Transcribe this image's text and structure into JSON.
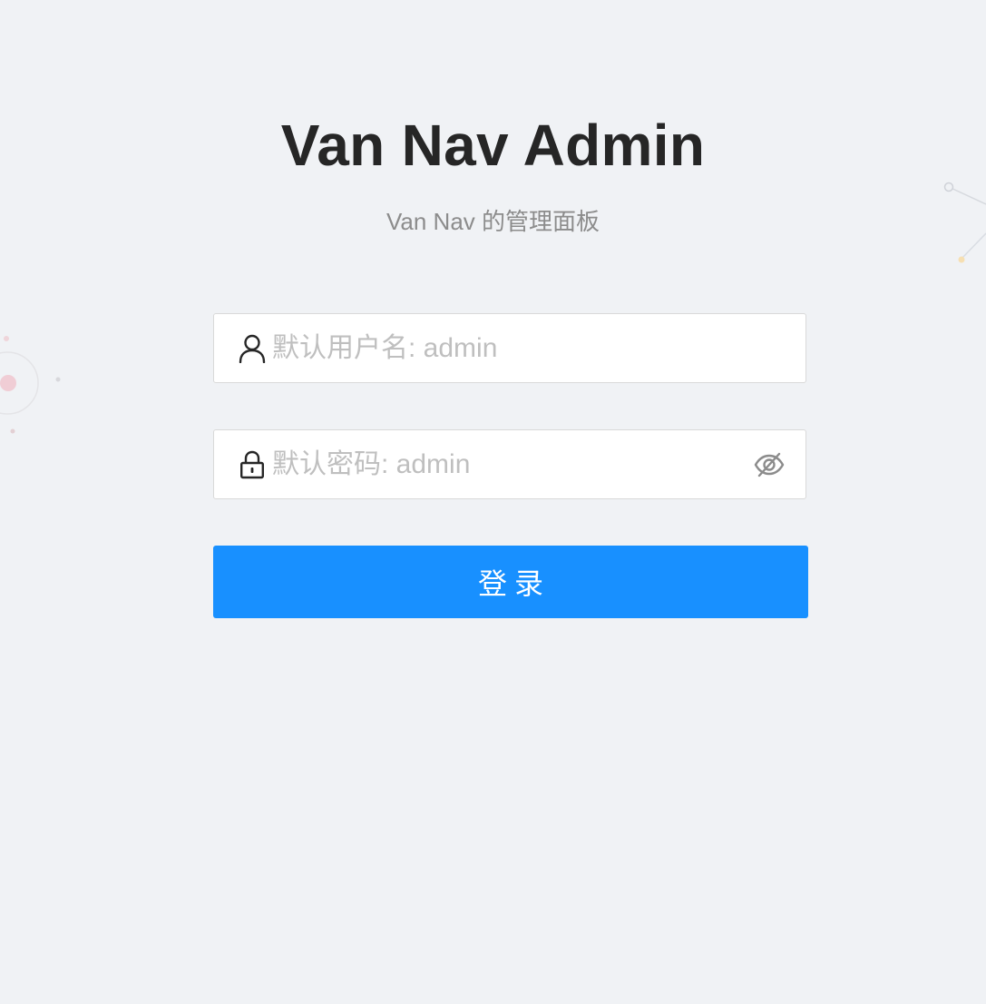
{
  "header": {
    "title": "Van Nav Admin",
    "subtitle": "Van Nav 的管理面板"
  },
  "form": {
    "username": {
      "placeholder": "默认用户名: admin",
      "value": "",
      "icon": "user-icon"
    },
    "password": {
      "placeholder": "默认密码: admin",
      "value": "",
      "icon": "lock-icon",
      "toggle_icon": "eye-invisible-icon"
    },
    "submit_label": "登录"
  },
  "colors": {
    "background": "#f0f2f5",
    "primary": "#1890ff",
    "title": "#262626",
    "subtitle": "#8c8c8c",
    "placeholder": "#bfbfbf"
  }
}
